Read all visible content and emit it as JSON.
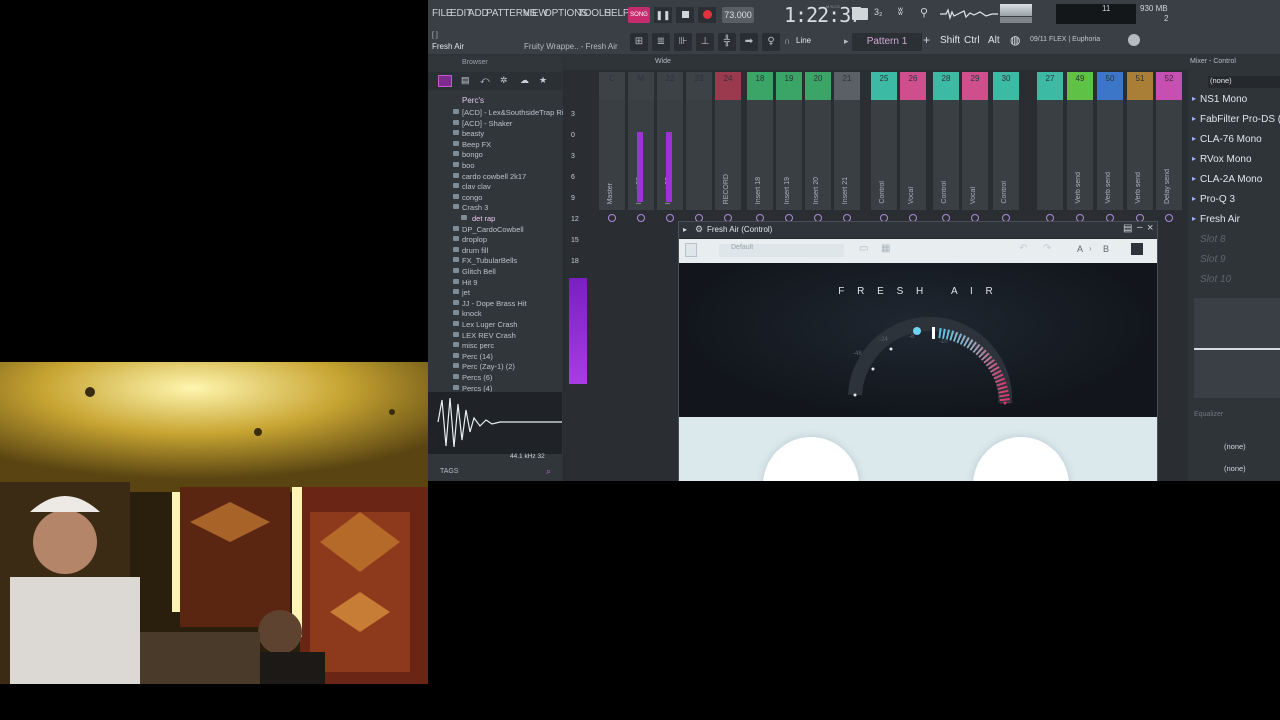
{
  "fl": {
    "menu": [
      "FILE",
      "EDIT",
      "ADD",
      "PATTERNS",
      "VIEW",
      "OPTIONS",
      "TOOLS",
      "HELP"
    ],
    "song_badge": "SONG",
    "tempo": "73.000",
    "time": "1:22:37",
    "time_unit": "M:S:CS",
    "cpu": "11",
    "ram": "930 MB",
    "voices": "2",
    "hint_line1": "[ ]",
    "hint_line2": "Fresh Air",
    "hint_right": "Fruity Wrappe.. - Fresh Air",
    "snap": "Line",
    "pattern": "Pattern 1",
    "shift": "Shift",
    "ctrl": "Ctrl",
    "alt": "Alt",
    "flex": "09/11 FLEX | Euphoria"
  },
  "browser": {
    "title": "Browser",
    "root": "Perc's",
    "items": [
      "[ACD] - Lex&SouthsideTrap Rim",
      "[ACD] - Shaker",
      "beasty",
      "Beep FX",
      "bongo",
      "boo",
      "cardo cowbell 2k17",
      "clav clav",
      "congo",
      "Crash 3",
      "det rap",
      "DP_CardoCowbell",
      "droplop",
      "drum fill",
      "FX_TubularBells",
      "Glitch Bell",
      "Hit 9",
      "jet",
      "JJ - Dope Brass Hit",
      "knock",
      "Lex Luger Crash",
      "LEX REV Crash",
      "misc perc",
      "Perc (14)",
      "Perc (Zay-1) (2)",
      "Percs (6)",
      "Percs (4)"
    ],
    "sample_rate": "44.1 kHz 32",
    "tags": "TAGS"
  },
  "mixer": {
    "view": "Wide",
    "scale": [
      "3",
      "0",
      "3",
      "6",
      "9",
      "12",
      "15",
      "18"
    ],
    "strips": [
      {
        "num": "C",
        "name": "Master"
      },
      {
        "num": "M",
        "name": "Insert 22"
      },
      {
        "num": "22",
        "name": "Insert 23"
      },
      {
        "num": "23",
        "name": ""
      },
      {
        "num": "24",
        "name": "RECORD"
      },
      {
        "num": "18",
        "name": "Insert 18"
      },
      {
        "num": "19",
        "name": "Insert 19"
      },
      {
        "num": "20",
        "name": "Insert 20"
      },
      {
        "num": "21",
        "name": "Insert 21"
      },
      {
        "num": "25",
        "name": "Control"
      },
      {
        "num": "26",
        "name": "Vocal"
      },
      {
        "num": "28",
        "name": "Control"
      },
      {
        "num": "29",
        "name": "Vocal"
      },
      {
        "num": "30",
        "name": "Control"
      },
      {
        "num": "27",
        "name": ""
      },
      {
        "num": "49",
        "name": "Verb send"
      },
      {
        "num": "50",
        "name": "Verb send"
      },
      {
        "num": "51",
        "name": "Verb send"
      },
      {
        "num": "52",
        "name": "Delay send"
      },
      {
        "num": "53",
        "name": "Delay send"
      }
    ]
  },
  "control": {
    "title": "Mixer - Control",
    "input": "(none)",
    "slots": [
      "NS1 Mono",
      "FabFilter Pro-DS (M",
      "CLA-76 Mono",
      "RVox Mono",
      "CLA-2A Mono",
      "Pro-Q 3",
      "Fresh Air"
    ],
    "empty_slots": [
      "Slot 8",
      "Slot 9",
      "Slot 10"
    ],
    "equalizer": "Equalizer",
    "out1": "(none)",
    "out2": "(none)"
  },
  "plugin": {
    "window_title": "Fresh Air (Control)",
    "preset": "Default",
    "ab_a": "A",
    "ab_b": "B",
    "brand": "F R E S H   A I R",
    "knob_labels": [
      "-48",
      "-24",
      "-8",
      "-10"
    ]
  }
}
